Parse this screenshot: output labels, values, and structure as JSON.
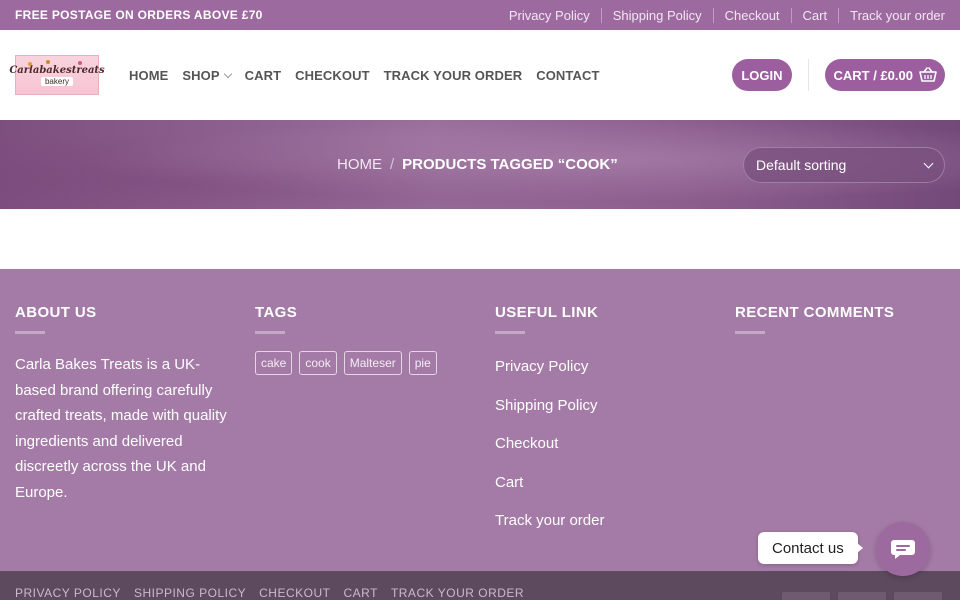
{
  "topbar": {
    "promo": "FREE POSTAGE ON ORDERS ABOVE £70",
    "links": [
      "Privacy Policy",
      "Shipping Policy",
      "Checkout",
      "Cart",
      "Track your order"
    ]
  },
  "header": {
    "logo_line1": "Carlabakestreats",
    "logo_line2": "bakery",
    "nav": [
      "HOME",
      "SHOP",
      "CART",
      "CHECKOUT",
      "TRACK YOUR ORDER",
      "CONTACT"
    ],
    "login": "LOGIN",
    "cart": "CART / £0.00"
  },
  "banner": {
    "breadcrumb_home": "HOME",
    "breadcrumb_sep": "/",
    "breadcrumb_current": "PRODUCTS TAGGED “COOK”",
    "sorting": "Default sorting"
  },
  "footer": {
    "about_title": "ABOUT US",
    "about_text": "Carla Bakes Treats is a UK-based brand offering carefully crafted treats, made with quality ingredients and delivered discreetly across the UK and Europe.",
    "tags_title": "TAGS",
    "tags": [
      "cake",
      "cook",
      "Malteser",
      "pie"
    ],
    "useful_title": "USEFUL LINK",
    "useful_links": [
      "Privacy Policy",
      "Shipping Policy",
      "Checkout",
      "Cart",
      "Track your order"
    ],
    "recent_title": "RECENT COMMENTS"
  },
  "bottombar": {
    "links": [
      "PRIVACY POLICY",
      "SHIPPING POLICY",
      "CHECKOUT",
      "CART",
      "TRACK YOUR ORDER"
    ]
  },
  "contact": {
    "label": "Contact us"
  },
  "colors": {
    "brand": "#9c5e9f",
    "topbar": "#9c6a9f",
    "footer": "#a47ba6",
    "bottombar": "#5e4a5f"
  },
  "icons": {
    "cart": "basket-icon",
    "contact": "chat-bubble-icon",
    "shop_dropdown": "chevron-down-icon",
    "sorting_dropdown": "chevron-down-icon"
  }
}
